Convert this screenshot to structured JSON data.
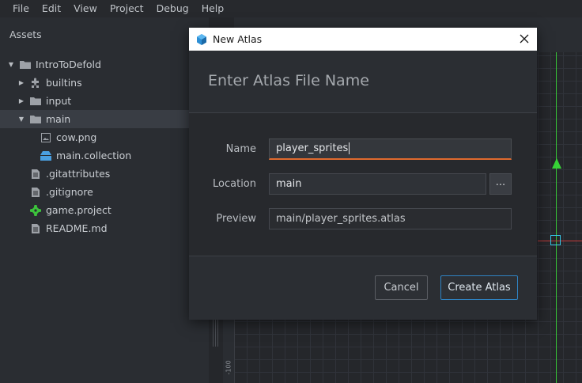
{
  "menu": [
    "File",
    "Edit",
    "View",
    "Project",
    "Debug",
    "Help"
  ],
  "assets": {
    "title": "Assets",
    "tree": [
      {
        "label": "IntroToDefold",
        "icon": "folder-icon",
        "expanded": true,
        "depth": 0
      },
      {
        "label": "builtins",
        "icon": "puzzle-icon",
        "expanded": false,
        "depth": 1
      },
      {
        "label": "input",
        "icon": "folder-icon",
        "expanded": false,
        "depth": 1
      },
      {
        "label": "main",
        "icon": "folder-icon",
        "expanded": true,
        "depth": 1,
        "selected": true
      },
      {
        "label": "cow.png",
        "icon": "image-icon",
        "depth": 2
      },
      {
        "label": "main.collection",
        "icon": "collection-icon",
        "depth": 2
      },
      {
        "label": ".gitattributes",
        "icon": "file-icon",
        "depth": 1
      },
      {
        "label": ".gitignore",
        "icon": "file-icon",
        "depth": 1
      },
      {
        "label": "game.project",
        "icon": "gear-icon",
        "depth": 1
      },
      {
        "label": "README.md",
        "icon": "file-icon",
        "depth": 1
      }
    ]
  },
  "scene": {
    "ruler_label": "-100",
    "colors": {
      "y_axis": "#37c337",
      "x_axis": "#c23a3a",
      "origin": "#36c6e8"
    }
  },
  "dialog": {
    "title": "New Atlas",
    "heading": "Enter Atlas File Name",
    "name_label": "Name",
    "name_value": "player_sprites",
    "location_label": "Location",
    "location_value": "main",
    "browse_label": "...",
    "preview_label": "Preview",
    "preview_value": "main/player_sprites.atlas",
    "cancel_label": "Cancel",
    "create_label": "Create Atlas",
    "colors": {
      "focus_underline": "#e06a2e",
      "primary_border": "#2f83c2"
    }
  }
}
